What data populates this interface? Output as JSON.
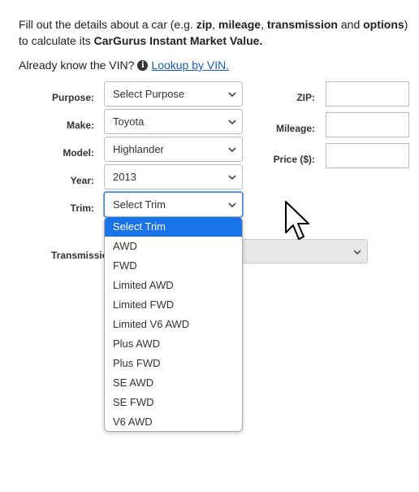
{
  "intro": {
    "p1": "Fill out the details about a car (e.g. ",
    "b1": "zip",
    "p2": ", ",
    "b2": "mileage",
    "p3": ", ",
    "b3": "transmission",
    "p4": " and ",
    "b4": "options",
    "p5": ") to calculate its ",
    "b5": "CarGurus Instant Market Value.",
    "vin_prefix": "Already know the VIN?",
    "vin_link": "Lookup by VIN."
  },
  "form": {
    "purpose": {
      "label": "Purpose:",
      "value": "Select Purpose"
    },
    "make": {
      "label": "Make:",
      "value": "Toyota"
    },
    "model": {
      "label": "Model:",
      "value": "Highlander"
    },
    "year": {
      "label": "Year:",
      "value": "2013"
    },
    "trim": {
      "label": "Trim:",
      "value": "Select Trim"
    },
    "transmission": {
      "label": "Transmission:"
    },
    "zip": {
      "label": "ZIP:",
      "value": ""
    },
    "mileage": {
      "label": "Mileage:",
      "value": ""
    },
    "price": {
      "label": "Price ($):",
      "value": ""
    }
  },
  "trim_options": [
    "Select Trim",
    "AWD",
    "FWD",
    "Limited AWD",
    "Limited FWD",
    "Limited V6 AWD",
    "Plus AWD",
    "Plus FWD",
    "SE AWD",
    "SE FWD",
    "V6 AWD"
  ],
  "colors": {
    "selected_option": "#1a73e8",
    "link": "#1a5fb4",
    "focus_border": "#4a7fd8"
  },
  "icons": {
    "info": "info-circle-icon",
    "chevron": "chevron-down-icon",
    "cursor": "mouse-pointer-icon"
  }
}
